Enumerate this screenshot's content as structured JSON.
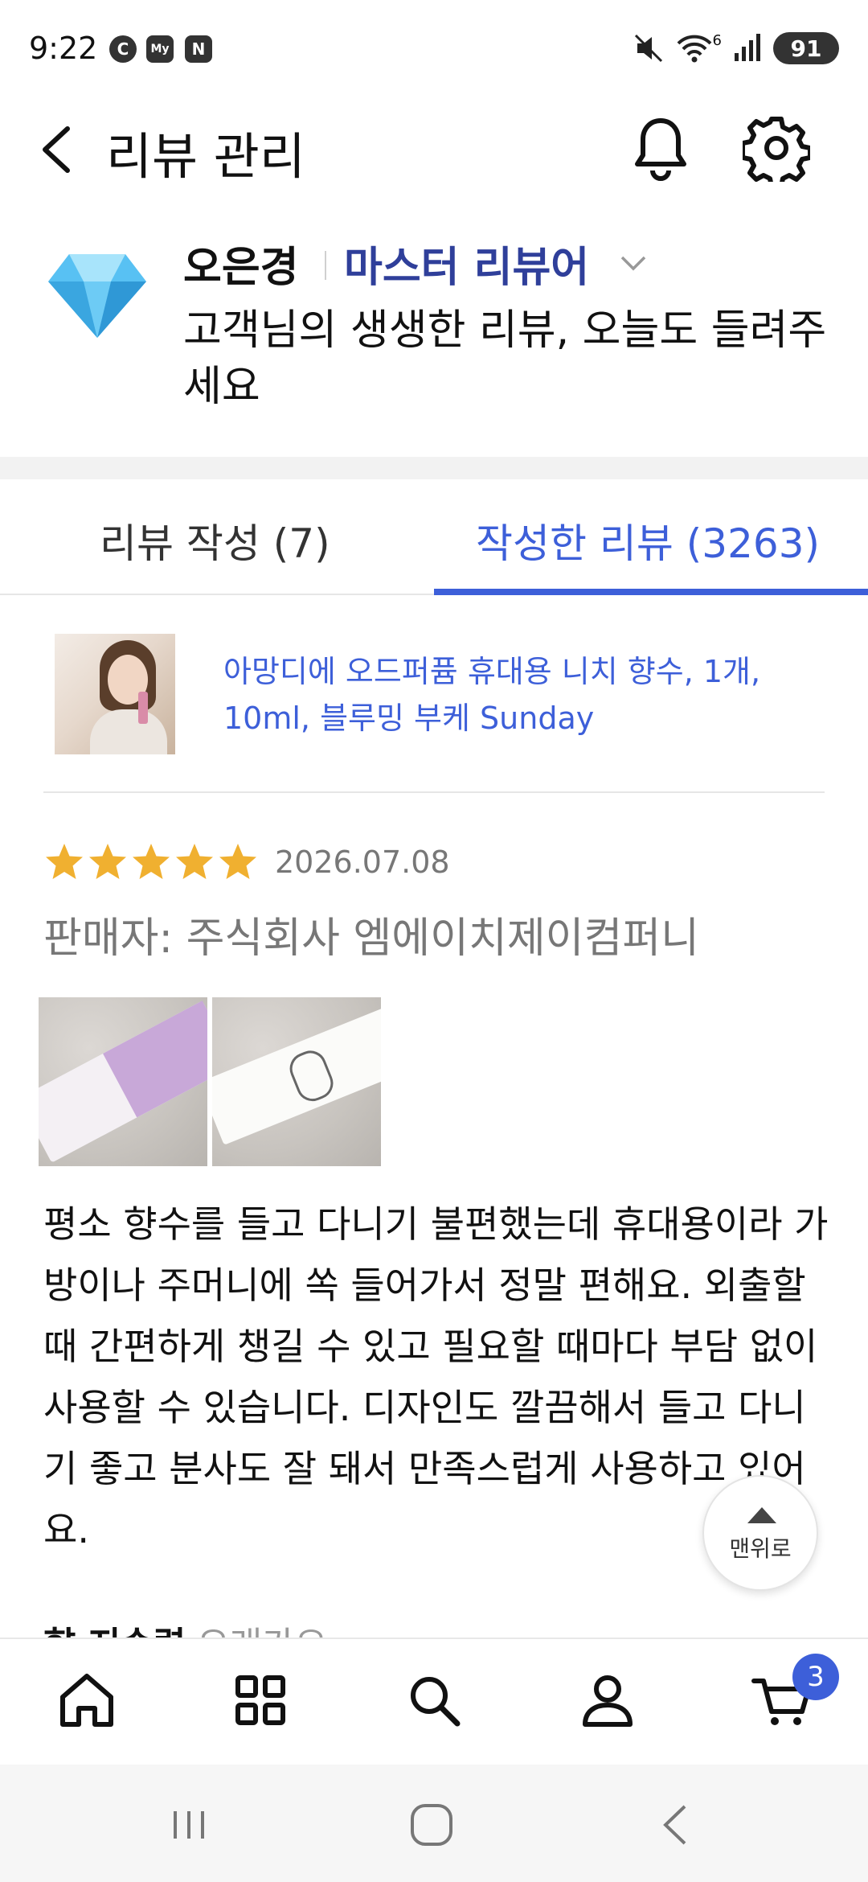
{
  "status_bar": {
    "time": "9:22",
    "app_icons": [
      "C",
      "My",
      "N"
    ],
    "battery": "91",
    "signal_label": "6"
  },
  "header": {
    "title": "리뷰 관리"
  },
  "profile": {
    "name": "오은경",
    "grade": "마스터 리뷰어",
    "message": "고객님의 생생한 리뷰, 오늘도 들려주세요"
  },
  "tabs": [
    {
      "label": "리뷰 작성 (7)",
      "active": false
    },
    {
      "label": "작성한 리뷰 (3263)",
      "active": true
    }
  ],
  "product": {
    "name": "아망디에 오드퍼퓸 휴대용 니치 향수, 1개, 10ml, 블루밍 부케 Sunday"
  },
  "review": {
    "rating": 5,
    "date": "2026.07.08",
    "seller": "판매자: 주식회사 엠에이치제이컴퍼니",
    "text": "평소 향수를 들고 다니기 불편했는데 휴대용이라 가방이나 주머니에 쏙 들어가서 정말 편해요. 외출할 때 간편하게 챙길 수 있고 필요할 때마다 부담 없이 사용할 수 있습니다. 디자인도 깔끔해서 들고 다니기 좋고 분사도 잘 돼서 만족스럽게 사용하고 있어요.",
    "cut_label": "향 지속력",
    "cut_value": "오래가요"
  },
  "scroll_top": {
    "label": "맨위로"
  },
  "bottom_nav": {
    "items": [
      "home-icon",
      "category-icon",
      "search-icon",
      "user-icon",
      "cart-icon"
    ],
    "cart_count": "3"
  },
  "colors": {
    "accent": "#3d5fd9",
    "grade": "#2f3f9a",
    "star": "#f0b030"
  }
}
